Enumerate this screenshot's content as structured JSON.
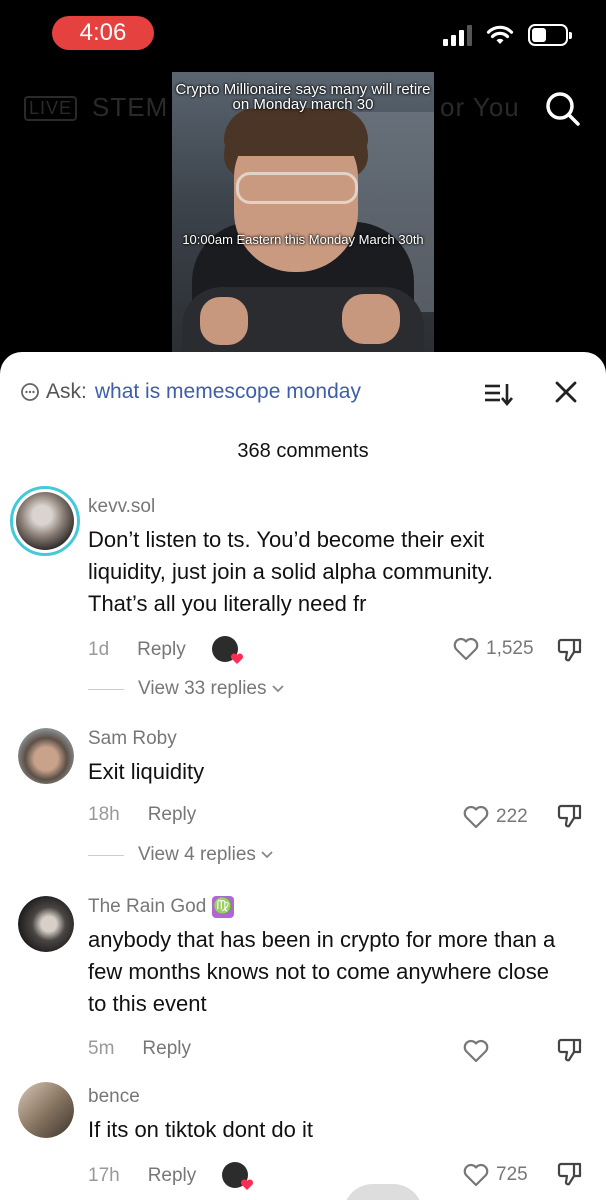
{
  "status": {
    "time": "4:06",
    "signal_bars": 4,
    "signal_active": 3,
    "battery_level": 0.45
  },
  "nav": {
    "live": "LIVE",
    "stem": "STEM",
    "for_you": "or You"
  },
  "video": {
    "caption_top": "Crypto Millionaire says many will retire on Monday march 30",
    "caption_mid": "10:00am Eastern this Monday March 30th"
  },
  "sheet": {
    "ask_label": "Ask:",
    "ask_query": "what is memescope monday",
    "comment_count": "368 comments"
  },
  "comments": [
    {
      "username": "kevv.sol",
      "text": "Don’t listen to ts. You’d become their exit liquidity, just join a solid alpha community. That’s all you literally need fr",
      "age": "1d",
      "reply": "Reply",
      "likes": "1,525",
      "view_replies": "View 33 replies"
    },
    {
      "username": "Sam Roby",
      "text": "Exit liquidity",
      "age": "18h",
      "reply": "Reply",
      "likes": "222",
      "view_replies": "View 4 replies"
    },
    {
      "username": "The Rain God",
      "badge": "♍",
      "text": "anybody that has been in crypto for more than a few months knows not to come anywhere close to this event",
      "age": "5m",
      "reply": "Reply",
      "likes": ""
    },
    {
      "username": "bence",
      "text": "If its on tiktok dont do it",
      "age": "17h",
      "reply": "Reply",
      "likes": "725"
    }
  ],
  "colors": {
    "time_pill": "#e5413f",
    "ask_query": "#3e5ea8",
    "story_ring": "#45c9d8",
    "heart_red": "#fe2c55"
  }
}
